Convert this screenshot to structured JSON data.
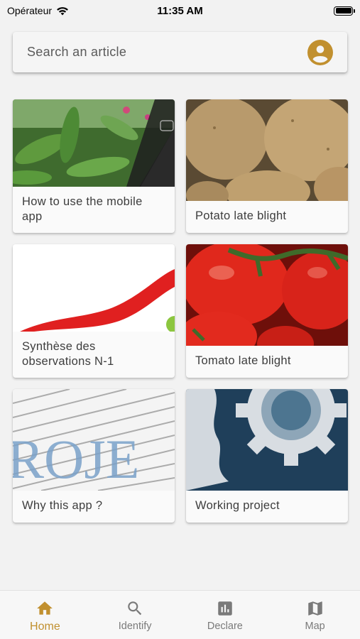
{
  "status_bar": {
    "carrier": "Opérateur",
    "time": "11:35 AM"
  },
  "search": {
    "placeholder": "Search an article",
    "icons": {
      "profile": "account-circle-icon"
    }
  },
  "articles": [
    {
      "title": "How to use the mobile app",
      "image": "phone-photographing-plant"
    },
    {
      "title": "Potato late blight",
      "image": "potatoes"
    },
    {
      "title": "Synthèse des observations N-1",
      "image": "red-curve-graphic"
    },
    {
      "title": "Tomato late blight",
      "image": "tomatoes"
    },
    {
      "title": "Why this app ?",
      "image": "text-collage"
    },
    {
      "title": "Working project",
      "image": "gear"
    }
  ],
  "bottom_nav": {
    "items": [
      {
        "label": "Home",
        "icon": "home-icon",
        "active": true
      },
      {
        "label": "Identify",
        "icon": "search-icon",
        "active": false
      },
      {
        "label": "Declare",
        "icon": "bar-chart-icon",
        "active": false
      },
      {
        "label": "Map",
        "icon": "map-icon",
        "active": false
      }
    ]
  },
  "colors": {
    "accent": "#c1902f",
    "background": "#f2f2f2",
    "inactive": "#7a7a7a"
  }
}
